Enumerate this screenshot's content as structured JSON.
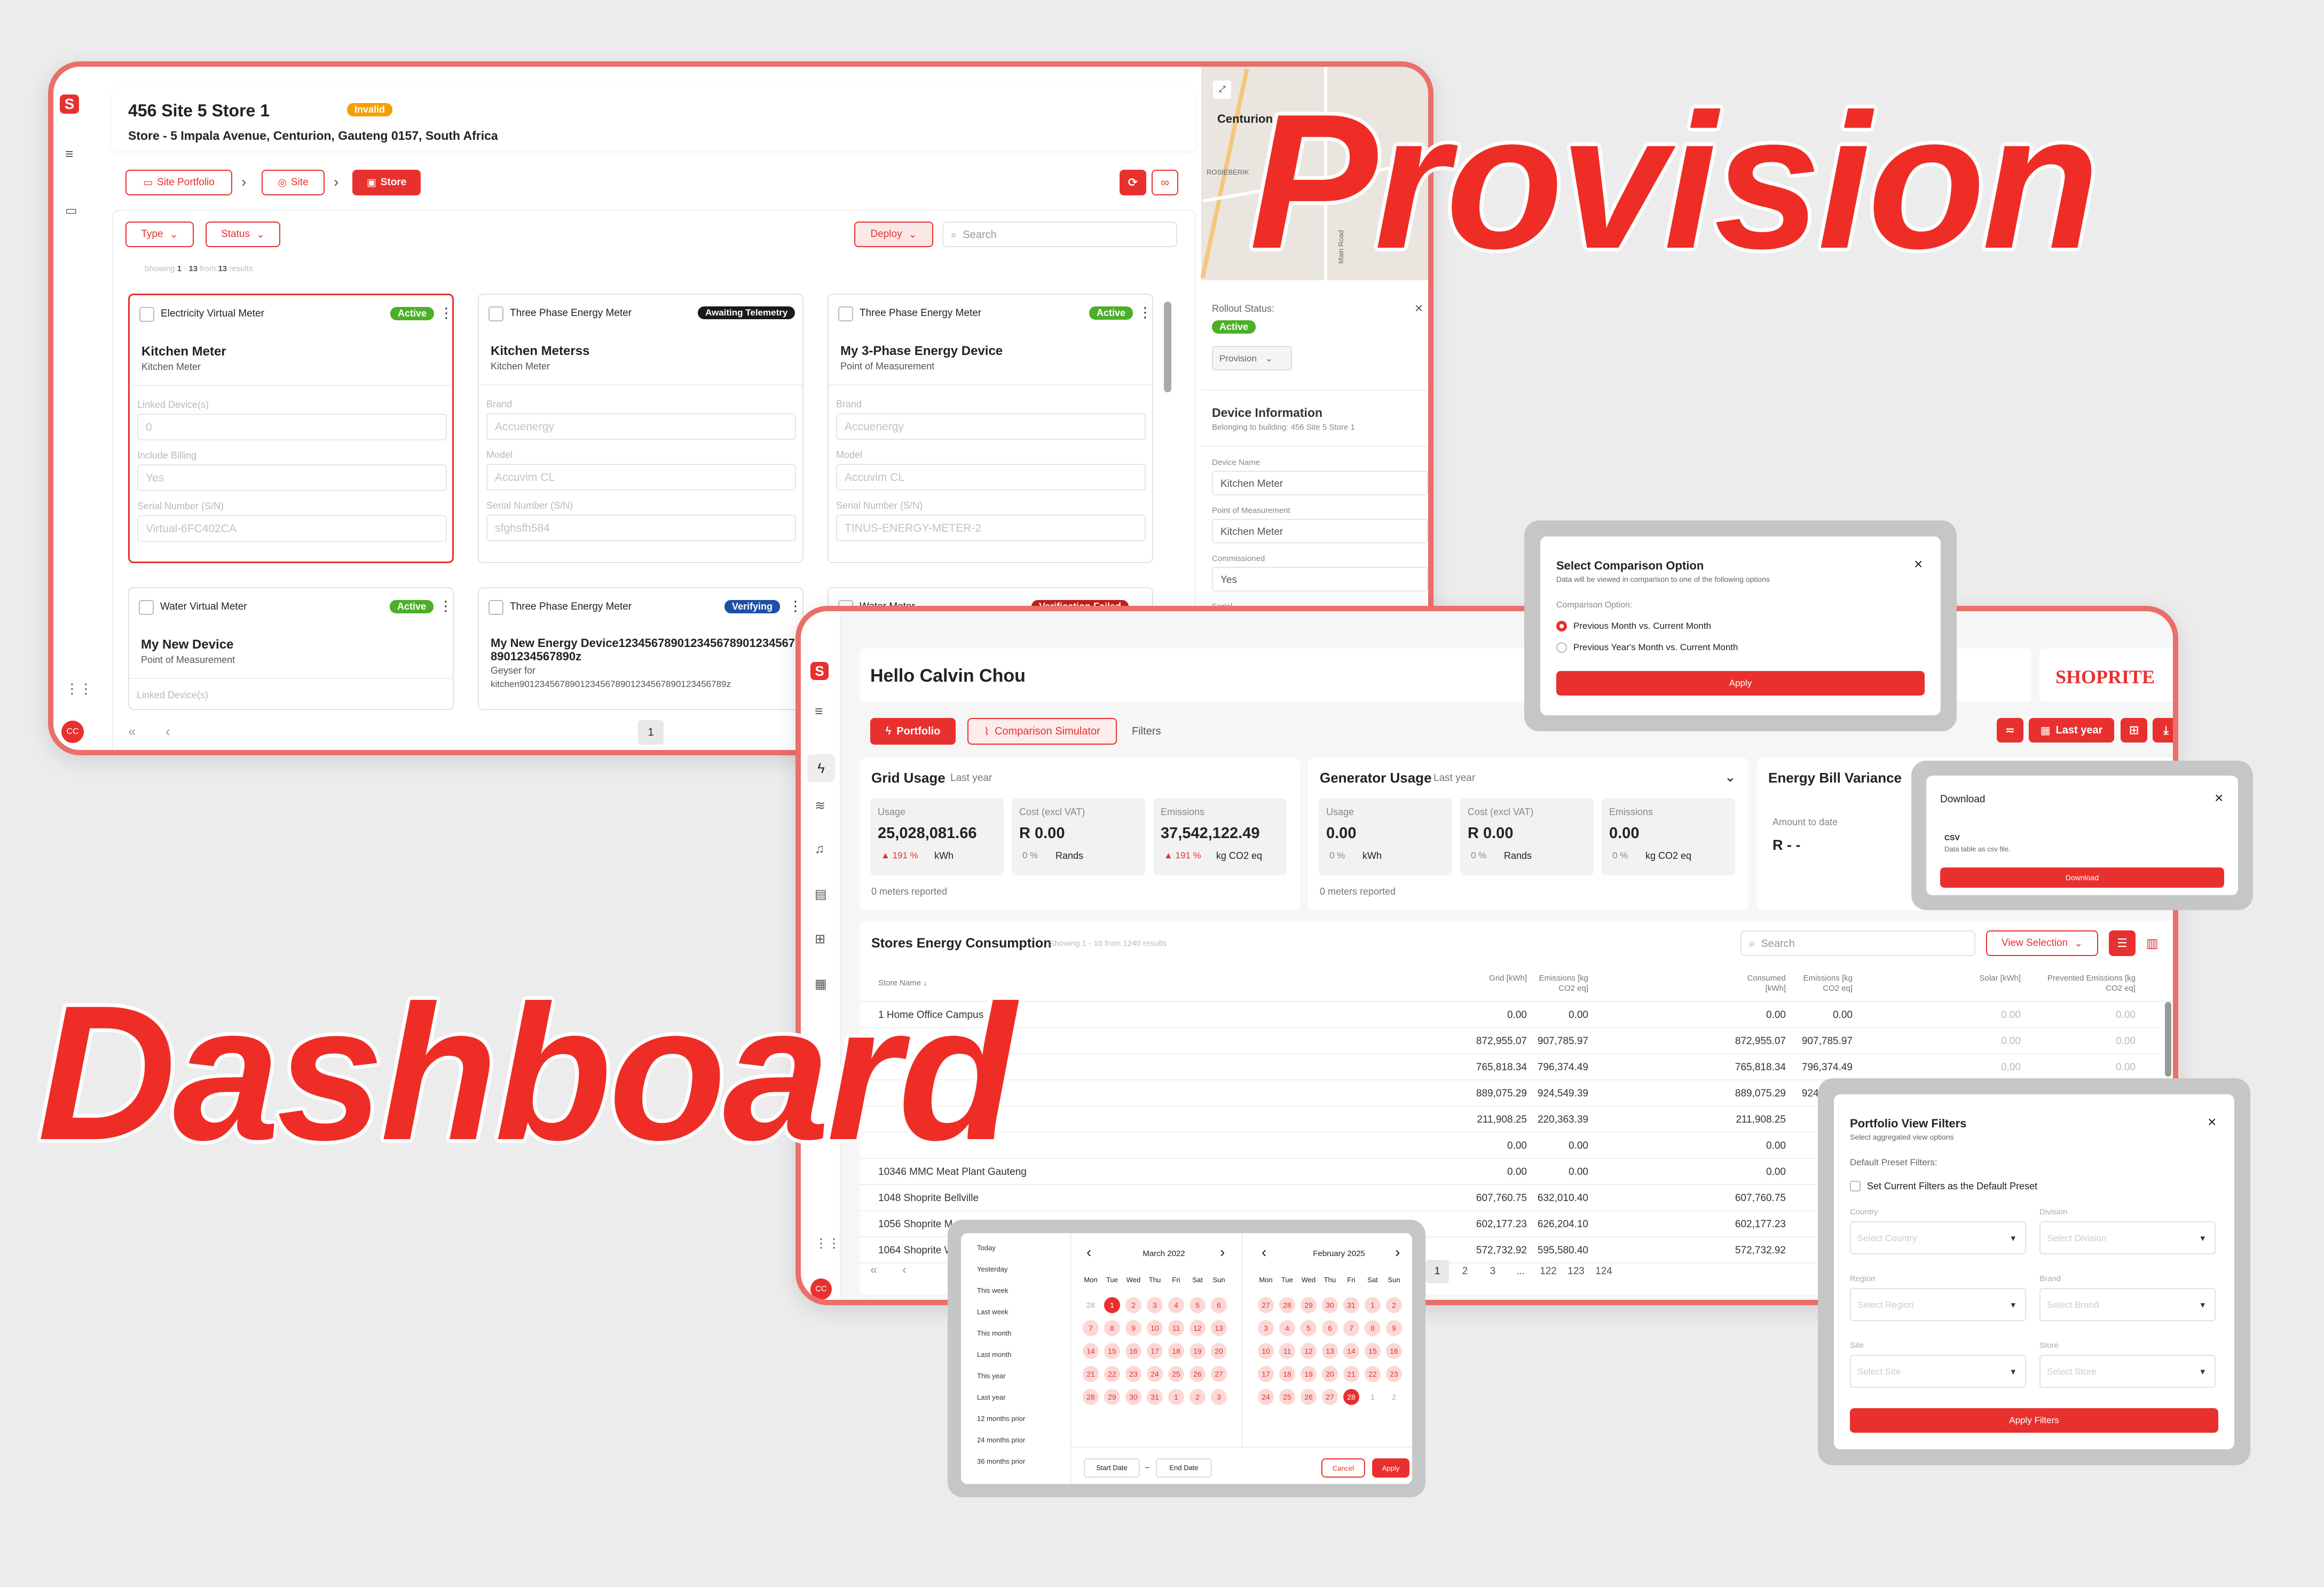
{
  "provision": {
    "site_title": "456 Site 5 Store 1",
    "status_badge": "Invalid",
    "address": "Store - 5 Impala Avenue, Centurion, Gauteng 0157, South Africa",
    "breadcrumb": [
      "Site Portfolio",
      "Site",
      "Store"
    ],
    "filters": {
      "type": "Type",
      "status": "Status",
      "deploy": "Deploy",
      "search_placeholder": "Search"
    },
    "showing": {
      "pre": "Showing",
      "from": "1",
      "dash": "-",
      "to": "13",
      "word": "from",
      "total": "13",
      "post": "results"
    },
    "labels": {
      "linked": "Linked Device(s)",
      "billing": "Include Billing",
      "serial": "Serial Number (S/N)",
      "brand": "Brand",
      "model": "Model"
    },
    "cards": [
      {
        "type": "Electricity Virtual Meter",
        "status": "Active",
        "name": "Kitchen Meter",
        "sub": "Kitchen Meter",
        "f1": "0",
        "f2": "Yes",
        "f3": "Virtual-6FC402CA"
      },
      {
        "type": "Three Phase Energy Meter",
        "status": "Awaiting Telemetry",
        "name": "Kitchen Meterss",
        "sub": "Kitchen Meter",
        "f1": "Accuenergy",
        "f2": "Accuvim CL",
        "f3": "sfghsfh584"
      },
      {
        "type": "Three Phase Energy Meter",
        "status": "Active",
        "name": "My 3-Phase Energy Device",
        "sub": "Point of Measurement",
        "f1": "Accuenergy",
        "f2": "Accuvim CL",
        "f3": "TINUS-ENERGY-METER-2"
      },
      {
        "type": "Water Virtual Meter",
        "status": "Active",
        "name": "My New Device",
        "sub": "Point of Measurement"
      },
      {
        "type": "Three Phase Energy Meter",
        "status": "Verifying",
        "name": "My New Energy Device1234567890123456789012345678901234567890z",
        "sub": "Geyser for",
        "extra": "kitchen90123456789012345678901234567890123456789z"
      },
      {
        "type": "Water Meter",
        "status": "Verification Failed"
      }
    ],
    "page": "1",
    "map": {
      "city": "Centurion",
      "street": "Main Road",
      "district": "ROSIEBERIK"
    },
    "rollout": {
      "label": "Rollout Status:",
      "status": "Active",
      "select": "Provision"
    },
    "device_info": {
      "title": "Device Information",
      "sub": "Belonging to building: 456 Site 5 Store 1",
      "name_label": "Device Name",
      "name_val": "Kitchen Meter",
      "pom_label": "Point of Measurement",
      "pom_val": "Kitchen Meter",
      "comm_label": "Commissioned",
      "comm_val": "Yes",
      "serial_label": "Serial"
    },
    "user_initials": "CC"
  },
  "headline": {
    "provision": "Provision",
    "dashboard": "Dashboard"
  },
  "dashboard": {
    "greeting": "Hello Calvin Chou",
    "brand": "SHOPRITE",
    "tabs": {
      "portfolio": "Portfolio",
      "simulator": "Comparison Simulator",
      "filters": "Filters"
    },
    "range_btn": "Last year",
    "grid": {
      "title": "Grid Usage",
      "period": "Last year",
      "usage_l": "Usage",
      "usage_v": "25,028,081.66",
      "usage_d": "▲ 191 %",
      "usage_u": "kWh",
      "cost_l": "Cost (excl VAT)",
      "cost_v": "R 0.00",
      "cost_d": "0 %",
      "cost_u": "Rands",
      "em_l": "Emissions",
      "em_v": "37,542,122.49",
      "em_d": "▲ 191 %",
      "em_u": "kg CO2 eq",
      "meters": "0 meters reported"
    },
    "gen": {
      "title": "Generator Usage",
      "period": "Last year",
      "usage_l": "Usage",
      "usage_v": "0.00",
      "usage_d": "0 %",
      "usage_u": "kWh",
      "cost_l": "Cost (excl VAT)",
      "cost_v": "R 0.00",
      "cost_d": "0 %",
      "cost_u": "Rands",
      "em_l": "Emissions",
      "em_v": "0.00",
      "em_d": "0 %",
      "em_u": "kg CO2 eq",
      "meters": "0 meters reported"
    },
    "bill": {
      "title": "Energy Bill Variance",
      "amount_l": "Amount to date",
      "amount_v": "R - -"
    },
    "table": {
      "title": "Stores Energy Consumption",
      "showing": "Showing 1 - 10 from 1240 results",
      "search": "Search",
      "view_sel": "View Selection",
      "headers": [
        "Store Name",
        "Grid [kWh]",
        "Emissions [kg CO2 eq]",
        "Consumed [kWh]",
        "Emissions [kg CO2 eq]",
        "Solar [kWh]",
        "Prevented Emissions [kg CO2 eq]"
      ],
      "rows": [
        {
          "name": "1 Home Office Campus",
          "g": "0.00",
          "e": "0.00",
          "c": "0.00",
          "e2": "0.00",
          "s": "0.00",
          "p": "0.00"
        },
        {
          "name": "",
          "g": "872,955.07",
          "e": "907,785.97",
          "c": "872,955.07",
          "e2": "907,785.97",
          "s": "0.00",
          "p": "0.00"
        },
        {
          "name": "",
          "g": "765,818.34",
          "e": "796,374.49",
          "c": "765,818.34",
          "e2": "796,374.49",
          "s": "0.00",
          "p": "0.00"
        },
        {
          "name": "",
          "g": "889,075.29",
          "e": "924,549.39",
          "c": "889,075.29",
          "e2": "924,549.39",
          "s": "0.00",
          "p": "0.00"
        },
        {
          "name": "",
          "g": "211,908.25",
          "e": "220,363.39",
          "c": "211,908.25",
          "e2": "",
          "s": "",
          "p": ""
        },
        {
          "name": "",
          "g": "0.00",
          "e": "0.00",
          "c": "0.00",
          "e2": "",
          "s": "",
          "p": ""
        },
        {
          "name": "10346 MMC Meat Plant Gauteng",
          "g": "0.00",
          "e": "0.00",
          "c": "0.00",
          "e2": "",
          "s": "",
          "p": ""
        },
        {
          "name": "1048 Shoprite Bellville",
          "g": "607,760.75",
          "e": "632,010.40",
          "c": "607,760.75",
          "e2": "",
          "s": "",
          "p": ""
        },
        {
          "name": "1056 Shoprite M",
          "g": "602,177.23",
          "e": "626,204.10",
          "c": "602,177.23",
          "e2": "",
          "s": "",
          "p": ""
        },
        {
          "name": "1064 Shoprite W",
          "g": "572,732.92",
          "e": "595,580.40",
          "c": "572,732.92",
          "e2": "",
          "s": "",
          "p": ""
        }
      ],
      "pages": [
        "1",
        "2",
        "3",
        "...",
        "122",
        "123",
        "124"
      ]
    },
    "user_initials": "CC"
  },
  "comparison_modal": {
    "title": "Select Comparison Option",
    "desc": "Data will be viewed in comparison to one of the following options",
    "label": "Comparison Option:",
    "opt1": "Previous Month vs. Current Month",
    "opt2": "Previous Year's Month vs. Current Month",
    "apply": "Apply"
  },
  "download_modal": {
    "title": "Download",
    "fmt": "CSV",
    "desc": "Data table as csv file.",
    "btn": "Download"
  },
  "filters_modal": {
    "title": "Portfolio View Filters",
    "sub": "Select aggregated view options",
    "preset_label": "Default Preset Filters:",
    "preset_chk": "Set Current Filters as the Default Preset",
    "country": "Country",
    "country_ph": "Select Country",
    "division": "Division",
    "division_ph": "Select Division",
    "region": "Region",
    "region_ph": "Select Region",
    "brand": "Brand",
    "brand_ph": "Select Brand",
    "site": "Site",
    "site_ph": "Select Site",
    "store": "Store",
    "store_ph": "Select Store",
    "apply": "Apply Filters"
  },
  "date_picker": {
    "presets": [
      "Today",
      "Yesterday",
      "This week",
      "Last week",
      "This month",
      "Last month",
      "This year",
      "Last year",
      "12 months prior",
      "24 months prior",
      "36 months prior"
    ],
    "left_month": "March 2022",
    "right_month": "February 2025",
    "weekdays": [
      "Mon",
      "Tue",
      "Wed",
      "Thu",
      "Fri",
      "Sat",
      "Sun"
    ],
    "left_days": [
      "28",
      "1",
      "2",
      "3",
      "4",
      "5",
      "6",
      "7",
      "8",
      "9",
      "10",
      "11",
      "12",
      "13",
      "14",
      "15",
      "16",
      "17",
      "18",
      "19",
      "20",
      "21",
      "22",
      "23",
      "24",
      "25",
      "26",
      "27",
      "28",
      "29",
      "30",
      "31",
      "1",
      "2",
      "3"
    ],
    "right_days": [
      "27",
      "28",
      "29",
      "30",
      "31",
      "1",
      "2",
      "3",
      "4",
      "5",
      "6",
      "7",
      "8",
      "9",
      "10",
      "11",
      "12",
      "13",
      "14",
      "15",
      "16",
      "17",
      "18",
      "19",
      "20",
      "21",
      "22",
      "23",
      "24",
      "25",
      "26",
      "27",
      "28",
      "1",
      "2"
    ],
    "start": "Start Date",
    "sep": "–",
    "end": "End Date",
    "cancel": "Cancel",
    "apply": "Apply"
  },
  "colors": {
    "brand": "#e8312e",
    "active": "#4caf2a",
    "awaiting": "#1a1a1a",
    "verifying": "#1e4fa8",
    "failed": "#c0221f"
  }
}
